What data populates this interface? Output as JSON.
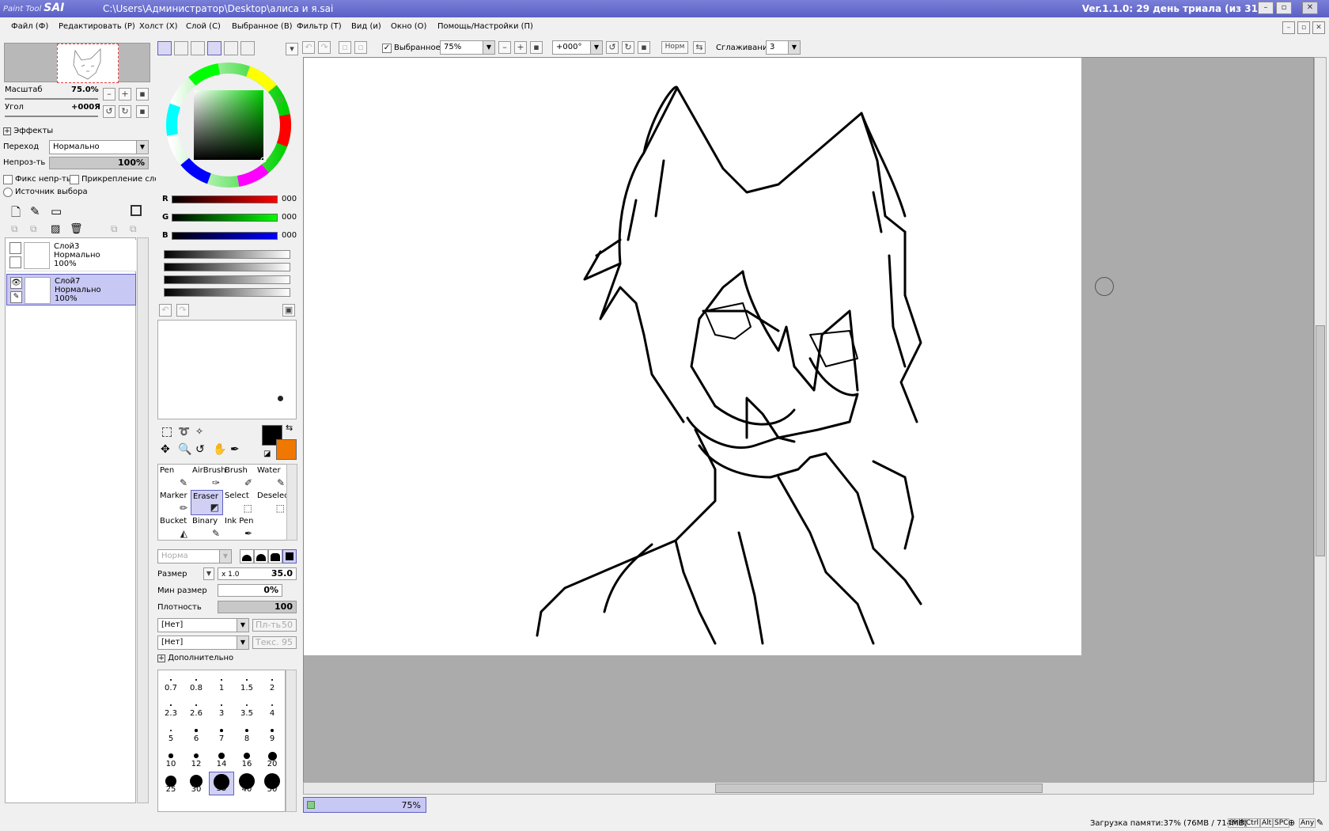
{
  "titlebar": {
    "logo_small": "Paint Tool",
    "logo_big": "SAI",
    "path": "C:\\Users\\Администратор\\Desktop\\алиса и я.sai",
    "version": "Ver.1.1.0: 29 день триала (из 31"
  },
  "menu": [
    "Файл (Ф)",
    "Редактировать (Р)",
    "Холст (X)",
    "Слой (С)",
    "Выбранное (В)",
    "Фильтр (Т)",
    "Вид (и)",
    "Окно (О)",
    "Помощь/Настройки (П)"
  ],
  "navigator": {
    "zoom_label": "Масштаб",
    "zoom_value": "75.0%",
    "angle_label": "Угол",
    "angle_value": "+000Я"
  },
  "effects_label": "Эффекты",
  "blend": {
    "label": "Переход",
    "value": "Нормально"
  },
  "opacity": {
    "label": "Непроз-ть",
    "value": "100%"
  },
  "checks": {
    "preserve": "Фикс непр-ть",
    "clip": "Прикрепление слоя",
    "source": "Источник выбора"
  },
  "layers": [
    {
      "name": "Слой3",
      "mode": "Нормально",
      "opacity": "100%"
    },
    {
      "name": "Слой7",
      "mode": "Нормально",
      "opacity": "100%"
    }
  ],
  "color": {
    "r_label": "R",
    "g_label": "G",
    "b_label": "B",
    "r": "000",
    "g": "000",
    "b": "000",
    "primary": "#000000",
    "secondary": "#f07800"
  },
  "tools": [
    {
      "label": "Pen",
      "icon": "pen-icon"
    },
    {
      "label": "AirBrush",
      "icon": "airbrush-icon"
    },
    {
      "label": "Brush",
      "icon": "brush-icon"
    },
    {
      "label": "Water",
      "icon": "water-icon"
    },
    {
      "label": "Marker",
      "icon": "marker-icon"
    },
    {
      "label": "Eraser",
      "icon": "eraser-icon"
    },
    {
      "label": "Select",
      "icon": "select-icon"
    },
    {
      "label": "Deselect",
      "icon": "deselect-icon"
    },
    {
      "label": "Bucket",
      "icon": "bucket-icon"
    },
    {
      "label": "Binary",
      "icon": "binary-icon"
    },
    {
      "label": "Ink Pen",
      "icon": "inkpen-icon"
    }
  ],
  "brush": {
    "mode": "Норма",
    "size_label": "Размер",
    "size_mult": "x 1.0",
    "size_value": "35.0",
    "min_size_label": "Мин размер",
    "min_size_value": "0%",
    "density_label": "Плотность",
    "density_value": "100",
    "texture1": "[Нет]",
    "texture2": "[Нет]",
    "tex1_label": "Пл-ть",
    "tex1_value": "50",
    "tex2_label": "Текс.",
    "tex2_value": "95",
    "advanced_label": "Дополнительно"
  },
  "brush_sizes": [
    "0.7",
    "0.8",
    "1",
    "1.5",
    "2",
    "2.3",
    "2.6",
    "3",
    "3.5",
    "4",
    "5",
    "6",
    "7",
    "8",
    "9",
    "10",
    "12",
    "14",
    "16",
    "20",
    "25",
    "30",
    "35",
    "40",
    "50"
  ],
  "toolbar": {
    "selection_label": "Выбранное",
    "zoom": "75%",
    "angle": "+000°",
    "norm": "Норм",
    "smooth_label": "Сглаживание",
    "smooth_value": "3"
  },
  "doc_tab": "75%",
  "status": {
    "memory": "Загрузка памяти:37% (76MB / 714MB)",
    "keys": [
      "Shift",
      "Ctrl",
      "Alt",
      "SPC",
      "Any"
    ]
  }
}
